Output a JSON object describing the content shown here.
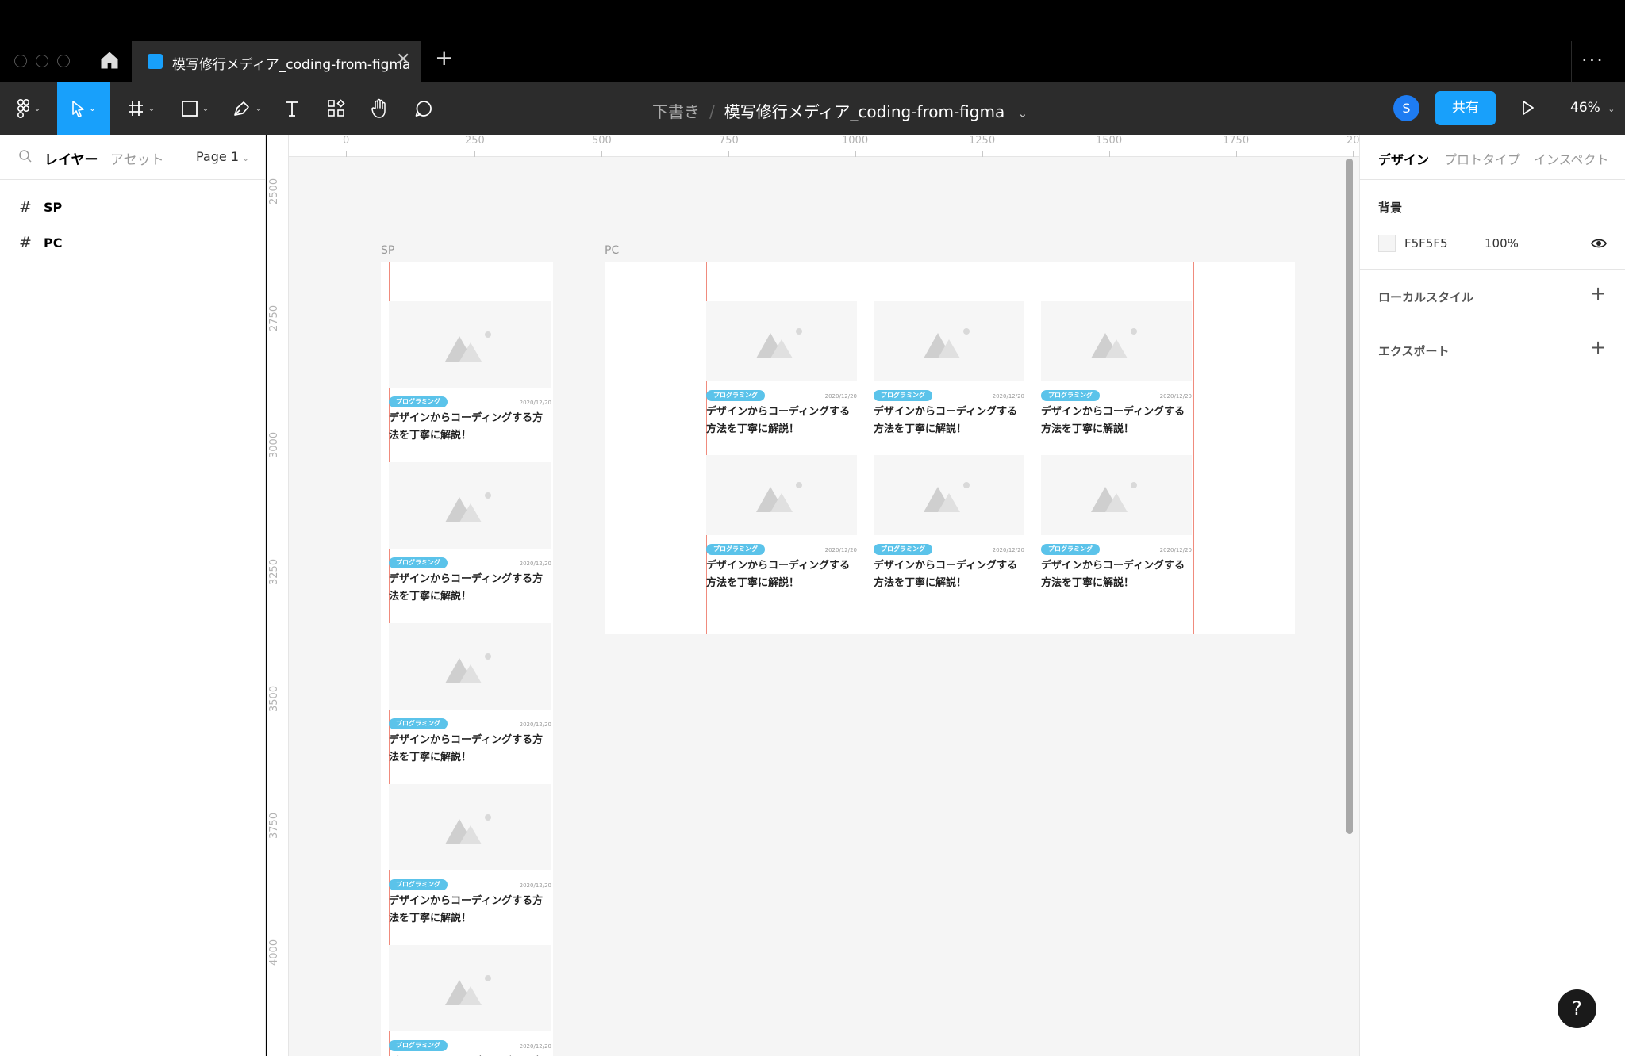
{
  "tab": {
    "title": "模写修行メディア_coding-from-figma",
    "close": "✕"
  },
  "new_tab": "+",
  "more": "···",
  "toolbar": {
    "breadcrumb_draft": "下書き",
    "breadcrumb_sep": "/",
    "file_name": "模写修行メディア_coding-from-figma",
    "file_chevron": "⌄",
    "avatar_initial": "S",
    "share_label": "共有",
    "zoom_level": "46%"
  },
  "left_panel": {
    "tab_layers": "レイヤー",
    "tab_assets": "アセット",
    "page_selector": "Page 1",
    "layers": [
      {
        "name": "SP"
      },
      {
        "name": "PC"
      }
    ]
  },
  "right_panel": {
    "tab_design": "デザイン",
    "tab_prototype": "プロトタイプ",
    "tab_inspect": "インスペクト",
    "background_label": "背景",
    "background_hex": "F5F5F5",
    "background_opacity": "100%",
    "local_styles_label": "ローカルスタイル",
    "export_label": "エクスポート"
  },
  "rulers": {
    "horizontal": [
      "0",
      "250",
      "500",
      "750",
      "1000",
      "1250",
      "1500",
      "1750",
      "20"
    ],
    "vertical": [
      "2500",
      "2750",
      "3000",
      "3250",
      "3500",
      "3750",
      "4000"
    ]
  },
  "frames": {
    "sp_label": "SP",
    "pc_label": "PC",
    "card_tag": "プログラミング",
    "card_date": "2020/12/20",
    "card_title": "デザインからコーディングする方法を丁寧に解説！"
  },
  "help_label": "?"
}
